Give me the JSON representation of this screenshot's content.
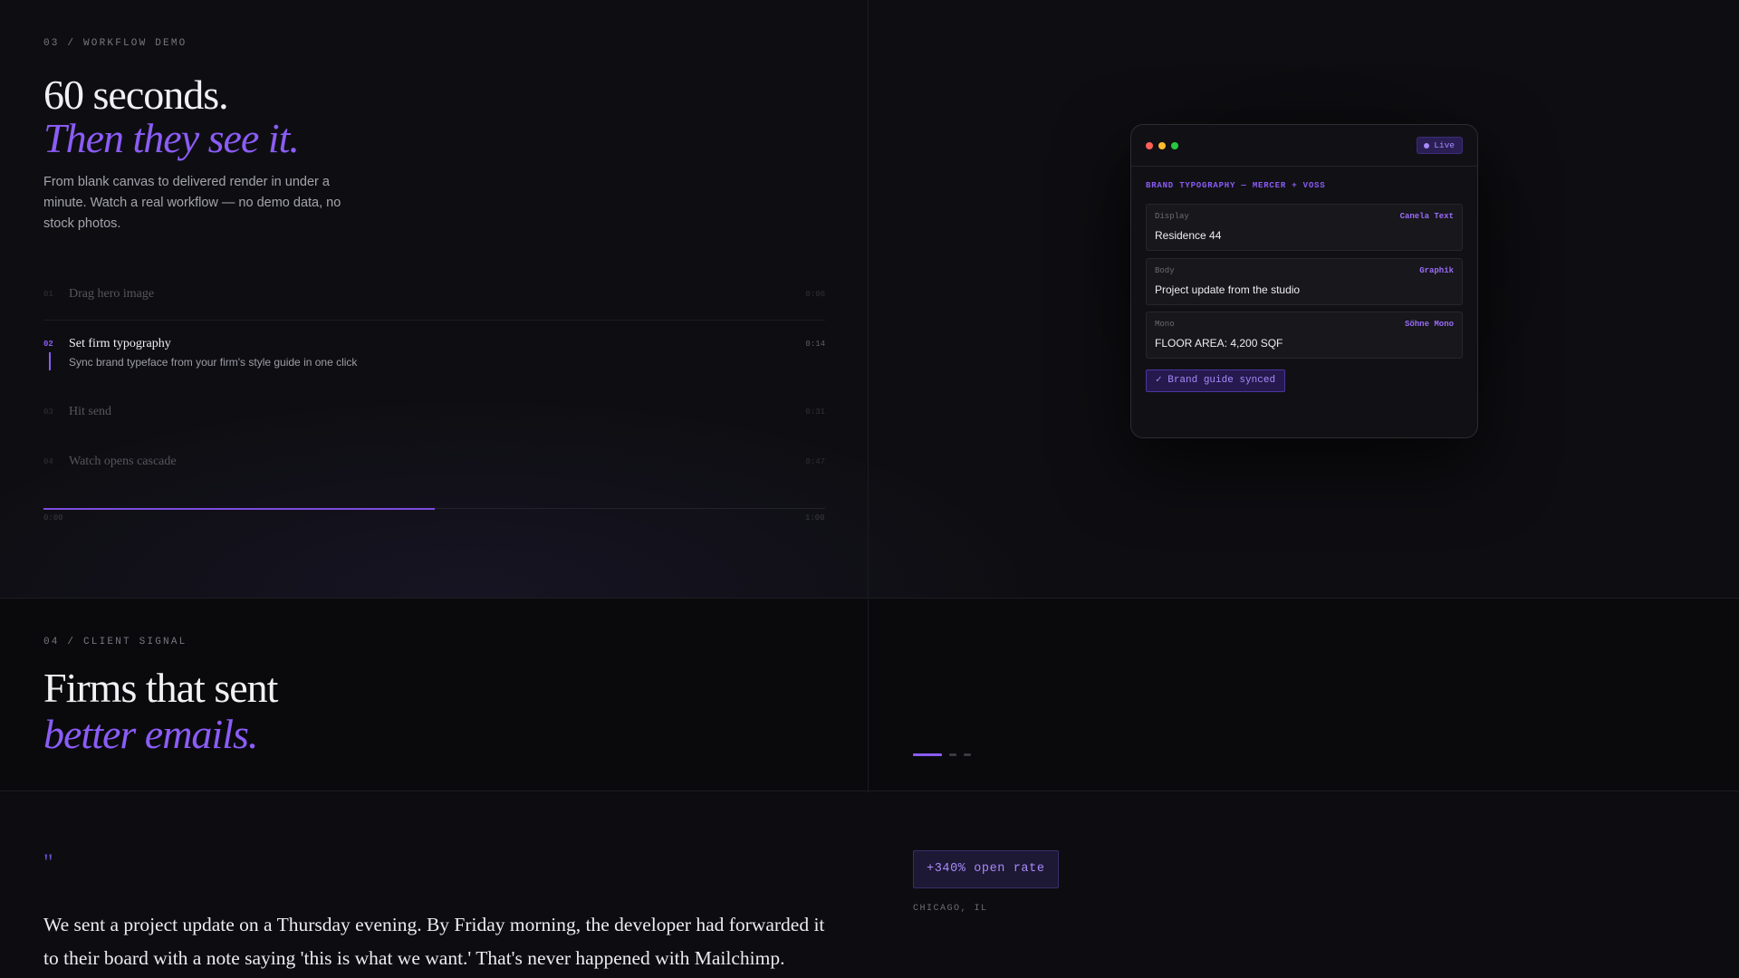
{
  "workflow": {
    "eyebrow": "03 / WORKFLOW DEMO",
    "heading_line1": "60 seconds.",
    "heading_line2": "Then they see it.",
    "lede": "From blank canvas to delivered render in under a minute. Watch a real workflow — no demo data, no stock photos.",
    "steps": [
      {
        "num": "01",
        "title": "Drag hero image",
        "time": "0:06"
      },
      {
        "num": "02",
        "title": "Set firm typography",
        "time": "0:14",
        "desc": "Sync brand typeface from your firm's style guide in one click",
        "active": true
      },
      {
        "num": "03",
        "title": "Hit send",
        "time": "0:31"
      },
      {
        "num": "04",
        "title": "Watch opens cascade",
        "time": "0:47"
      }
    ],
    "progress": {
      "start_label": "0:00",
      "end_label": "1:00",
      "fraction": 0.5
    }
  },
  "preview_card": {
    "live_label": "Live",
    "heading": "BRAND TYPOGRAPHY — MERCER + VOSS",
    "rows": [
      {
        "role": "Display",
        "face": "Canela Text",
        "sample": "Residence 44"
      },
      {
        "role": "Body",
        "face": "Graphik",
        "sample": "Project update from the studio"
      },
      {
        "role": "Mono",
        "face": "Söhne Mono",
        "sample": "FLOOR AREA: 4,200 SQF"
      }
    ],
    "synced_label": "✓ Brand guide synced",
    "dot_colors": [
      "#ff5f57",
      "#febc2e",
      "#28c840"
    ]
  },
  "client_signal": {
    "eyebrow": "04 / CLIENT SIGNAL",
    "heading_line1": "Firms that sent",
    "heading_line2": "better emails.",
    "carousel": {
      "count": 3,
      "active_index": 0
    }
  },
  "testimonial": {
    "quote_mark": "\"",
    "quote": "We sent a project update on a Thursday evening. By Friday morning, the developer had forwarded it to their board with a note saying 'this is what we want.' That's never happened with Mailchimp.",
    "metric": "+340% open rate",
    "location": "CHICAGO, IL"
  },
  "colors": {
    "accent": "#8b5cf6",
    "background": "#0e0e12"
  }
}
